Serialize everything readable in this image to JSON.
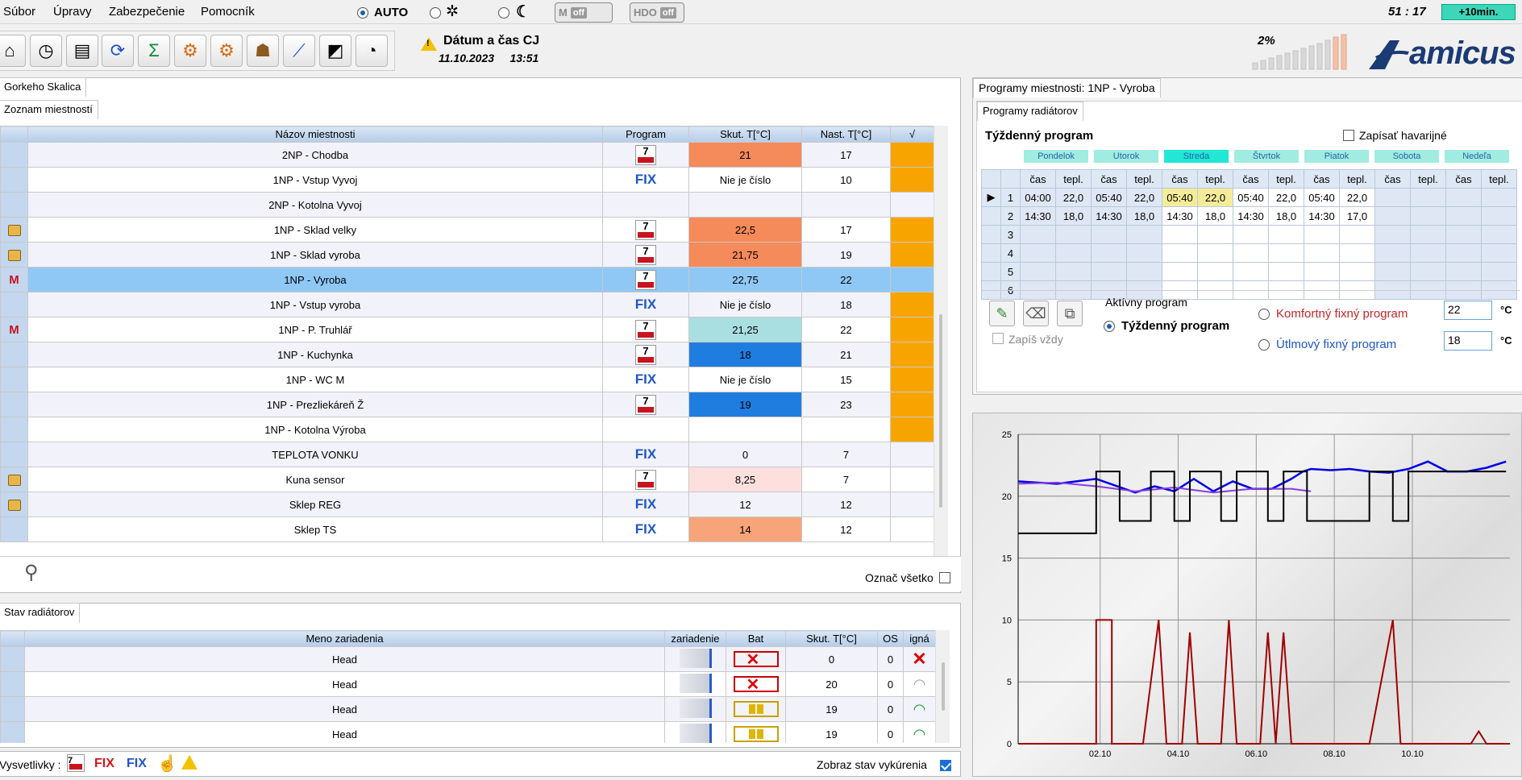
{
  "menu": {
    "file": "Súbor",
    "edit": "Úpravy",
    "security": "Zabezpečenie",
    "help": "Pomocník"
  },
  "mode": {
    "auto_label": "AUTO",
    "auto_selected": true,
    "toggle_m": "M",
    "toggle_m_state": "off",
    "toggle_hdo": "HDO",
    "toggle_hdo_state": "off"
  },
  "clock": "51 : 17",
  "extend_button": "+10min.",
  "toolbar_icons": [
    "home-settings-icon",
    "clock-icon",
    "devices-icon",
    "refresh-icon",
    "sum-icon",
    "gears-icon",
    "grid-gears-icon",
    "users-icon",
    "chart-icon",
    "frame-icon",
    "gauge-icon"
  ],
  "alert": {
    "title": "Dátum a čas CJ",
    "date": "11.10.2023",
    "time": "13:51"
  },
  "signal_percent": "2%",
  "brand": "amicus",
  "site_tab": "Gorkeho Skalica",
  "rooms_tab": "Zoznam miestností",
  "rooms_table": {
    "headers": [
      "Názov miestnosti",
      "Program",
      "Skut. T[°C]",
      "Nast. T[°C]",
      "√"
    ],
    "rows": [
      {
        "icon": "",
        "name": "2NP - Chodba",
        "program": "cal",
        "actual": "21",
        "set": "17",
        "actual_color": "#f58a5a",
        "flag": true,
        "selected": false
      },
      {
        "icon": "",
        "name": "1NP - Vstup Vyvoj",
        "program": "FIX",
        "actual": "Nie je číslo",
        "set": "10",
        "actual_color": "",
        "flag": true,
        "selected": false
      },
      {
        "icon": "",
        "name": "2NP - Kotolna Vyvoj",
        "program": "",
        "actual": "",
        "set": "",
        "actual_color": "",
        "flag": false,
        "selected": false
      },
      {
        "icon": "lock",
        "name": "1NP - Sklad velky",
        "program": "cal",
        "actual": "22,5",
        "set": "17",
        "actual_color": "#f58a5a",
        "flag": true,
        "selected": false
      },
      {
        "icon": "lock",
        "name": "1NP - Sklad vyroba",
        "program": "cal",
        "actual": "21,75",
        "set": "19",
        "actual_color": "#f58a5a",
        "flag": true,
        "selected": false
      },
      {
        "icon": "m",
        "name": "1NP - Vyroba",
        "program": "cal",
        "actual": "22,75",
        "set": "22",
        "actual_color": "",
        "flag": false,
        "selected": true
      },
      {
        "icon": "",
        "name": "1NP - Vstup vyroba",
        "program": "FIX",
        "actual": "Nie je číslo",
        "set": "18",
        "actual_color": "",
        "flag": true,
        "selected": false
      },
      {
        "icon": "m",
        "name": "1NP - P. Truhlář",
        "program": "cal",
        "actual": "21,25",
        "set": "22",
        "actual_color": "#a9dfe0",
        "flag": true,
        "selected": false
      },
      {
        "icon": "",
        "name": "1NP - Kuchynka",
        "program": "cal",
        "actual": "18",
        "set": "21",
        "actual_color": "#1f7de0",
        "flag": true,
        "selected": false
      },
      {
        "icon": "",
        "name": "1NP - WC M",
        "program": "FIX",
        "actual": "Nie je číslo",
        "set": "15",
        "actual_color": "",
        "flag": true,
        "selected": false
      },
      {
        "icon": "",
        "name": "1NP - Prezliekáreň Ž",
        "program": "cal",
        "actual": "19",
        "set": "23",
        "actual_color": "#1f7de0",
        "flag": true,
        "selected": false
      },
      {
        "icon": "",
        "name": "1NP - Kotolna Výroba",
        "program": "",
        "actual": "",
        "set": "",
        "actual_color": "",
        "flag": true,
        "selected": false
      },
      {
        "icon": "",
        "name": "TEPLOTA VONKU",
        "program": "FIX",
        "actual": "0",
        "set": "7",
        "actual_color": "",
        "flag": false,
        "selected": false
      },
      {
        "icon": "lock",
        "name": "Kuna sensor",
        "program": "cal",
        "actual": "8,25",
        "set": "7",
        "actual_color": "#fde0de",
        "flag": false,
        "selected": false
      },
      {
        "icon": "lock",
        "name": "Sklep REG",
        "program": "FIX",
        "actual": "12",
        "set": "12",
        "actual_color": "",
        "flag": false,
        "selected": false
      },
      {
        "icon": "",
        "name": "Sklep TS",
        "program": "FIX",
        "actual": "14",
        "set": "12",
        "actual_color": "#f7a47a",
        "flag": false,
        "selected": false
      }
    ]
  },
  "select_all_label": "Označ všetko",
  "radiators_tab": "Stav radiátorov",
  "radiators_table": {
    "headers": [
      "Meno zariadenia",
      "zariadenie",
      "Bat",
      "Skut. T[°C]",
      "OS",
      "igná"
    ],
    "rows": [
      {
        "name": "Head",
        "battery": "empty",
        "actual": "0",
        "os": "0",
        "signal": "none"
      },
      {
        "name": "Head",
        "battery": "empty",
        "actual": "20",
        "os": "0",
        "signal": "weak"
      },
      {
        "name": "Head",
        "battery": "half",
        "actual": "19",
        "os": "0",
        "signal": "good"
      },
      {
        "name": "Head",
        "battery": "half",
        "actual": "19",
        "os": "0",
        "signal": "good"
      }
    ]
  },
  "legend_label": "Vysvetlivky :",
  "legend_fix_red": "FIX",
  "legend_fix_blue": "FIX",
  "show_heating_label": "Zobraz stav vykúrenia",
  "show_heating_checked": true,
  "program_panel": {
    "title": "Programy miestnosti: 1NP - Vyroba",
    "subtab": "Programy radiátorov",
    "weekly_label": "Týždenný program",
    "write_emergency": "Zapísať havarijné",
    "days": [
      "Pondelok",
      "Utorok",
      "Streda",
      "Štvrtok",
      "Piatok",
      "Sobota",
      "Nedeľa"
    ],
    "active_day": "Streda",
    "col_time": "čas",
    "col_temp": "tepl.",
    "rows": [
      [
        "1",
        "04:00",
        "22,0",
        "05:40",
        "22,0",
        "05:40",
        "22,0",
        "05:40",
        "22,0",
        "05:40",
        "22,0",
        "",
        "",
        "",
        ""
      ],
      [
        "2",
        "14:30",
        "18,0",
        "14:30",
        "18,0",
        "14:30",
        "18,0",
        "14:30",
        "18,0",
        "14:30",
        "17,0",
        "",
        "",
        "",
        ""
      ],
      [
        "3",
        "",
        "",
        "",
        "",
        "",
        "",
        "",
        "",
        "",
        "",
        "",
        "",
        "",
        ""
      ],
      [
        "4",
        "",
        "",
        "",
        "",
        "",
        "",
        "",
        "",
        "",
        "",
        "",
        "",
        "",
        ""
      ],
      [
        "5",
        "",
        "",
        "",
        "",
        "",
        "",
        "",
        "",
        "",
        "",
        "",
        "",
        "",
        ""
      ],
      [
        "6",
        "",
        "",
        "",
        "",
        "",
        "",
        "",
        "",
        "",
        "",
        "",
        "",
        "",
        ""
      ]
    ],
    "write_always": "Zapíš vždy",
    "active_program_label": "Aktívny program",
    "weekly_radio": "Týždenný program",
    "comfort_radio": "Komfortný fixný program",
    "eco_radio": "Útlmový fixný program",
    "comfort_value": "22",
    "eco_value": "18",
    "unit": "°C"
  },
  "chart_data": {
    "type": "line",
    "x_ticks": [
      "02.10",
      "04.10",
      "06.10",
      "08.10",
      "10.10"
    ],
    "y_ticks": [
      "0",
      "5",
      "10",
      "15",
      "20",
      "25"
    ],
    "ylim": [
      0,
      25
    ],
    "xlim": [
      0,
      12.6
    ],
    "series": [
      {
        "color": "#0000e6",
        "values": [
          [
            0,
            21.2
          ],
          [
            1,
            21
          ],
          [
            2,
            21.4
          ],
          [
            3,
            20.3
          ],
          [
            3.5,
            20.8
          ],
          [
            4,
            20.4
          ],
          [
            4.5,
            21.4
          ],
          [
            5,
            20.4
          ],
          [
            5.5,
            21.2
          ],
          [
            6,
            20.6
          ],
          [
            6.5,
            20.6
          ],
          [
            7,
            21.4
          ],
          [
            7.3,
            22
          ],
          [
            7.5,
            22.2
          ],
          [
            8,
            22.1
          ],
          [
            8.5,
            22.2
          ],
          [
            9,
            22
          ],
          [
            9.5,
            21.9
          ],
          [
            10,
            22.2
          ],
          [
            10.5,
            22.8
          ],
          [
            11,
            22
          ],
          [
            11.5,
            22
          ],
          [
            12,
            22.3
          ],
          [
            12.5,
            22.8
          ]
        ]
      },
      {
        "color": "#8a3de0",
        "values": [
          [
            0,
            21
          ],
          [
            1,
            21.1
          ],
          [
            2,
            20.8
          ],
          [
            3,
            20.4
          ],
          [
            4,
            20.7
          ],
          [
            5,
            20.3
          ],
          [
            6,
            20.6
          ],
          [
            7,
            20.6
          ],
          [
            7.5,
            20.4
          ]
        ]
      },
      {
        "color": "#000000",
        "values": [
          [
            0,
            17
          ],
          [
            2,
            17
          ],
          [
            2,
            22
          ],
          [
            2.6,
            22
          ],
          [
            2.6,
            18
          ],
          [
            3.4,
            18
          ],
          [
            3.4,
            22
          ],
          [
            4,
            22
          ],
          [
            4,
            18
          ],
          [
            4.4,
            18
          ],
          [
            4.4,
            22
          ],
          [
            5.2,
            22
          ],
          [
            5.2,
            18
          ],
          [
            5.6,
            18
          ],
          [
            5.6,
            22
          ],
          [
            6.4,
            22
          ],
          [
            6.4,
            18
          ],
          [
            6.8,
            18
          ],
          [
            6.8,
            22
          ],
          [
            7.4,
            22
          ],
          [
            7.4,
            18
          ],
          [
            9,
            18
          ],
          [
            9,
            22
          ],
          [
            9.6,
            22
          ],
          [
            9.6,
            18
          ],
          [
            10,
            18
          ],
          [
            10,
            22
          ],
          [
            12.5,
            22
          ]
        ]
      },
      {
        "color": "#a00000",
        "values": [
          [
            0,
            0
          ],
          [
            2,
            0
          ],
          [
            2,
            10
          ],
          [
            2.4,
            10
          ],
          [
            2.4,
            0
          ],
          [
            3.2,
            0
          ],
          [
            3.6,
            10
          ],
          [
            3.8,
            0
          ],
          [
            4.2,
            0
          ],
          [
            4.4,
            9
          ],
          [
            4.6,
            0
          ],
          [
            5.2,
            0
          ],
          [
            5.4,
            10
          ],
          [
            5.6,
            0
          ],
          [
            6.2,
            0
          ],
          [
            6.4,
            9
          ],
          [
            6.6,
            0
          ],
          [
            6.8,
            9
          ],
          [
            7,
            0
          ],
          [
            9,
            0
          ],
          [
            9.6,
            10
          ],
          [
            9.8,
            0
          ],
          [
            11.6,
            0
          ],
          [
            11.8,
            1
          ],
          [
            12,
            0
          ],
          [
            12.6,
            0
          ]
        ]
      }
    ]
  }
}
